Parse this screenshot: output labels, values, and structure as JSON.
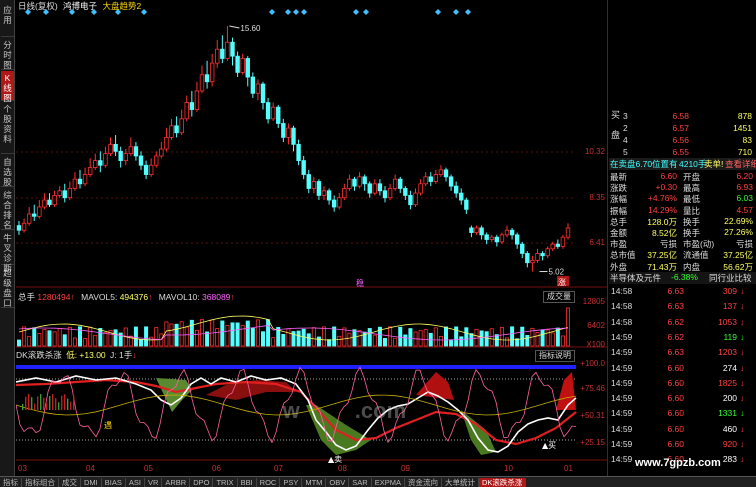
{
  "sidebar": {
    "tabs": [
      "应用",
      "分时图",
      "K线图",
      "个股资料",
      "自选股",
      "综合排名",
      "牛叉诊断",
      "超级盘口"
    ],
    "active": 2
  },
  "header": {
    "period": "日线(复权)",
    "stock": "鸿博电子",
    "overlay": "大盘趋势2"
  },
  "price_chart": {
    "high_label": "15.60",
    "low_label": "5.02",
    "event_mark": "稳",
    "event_mark2": "涨",
    "y_ticks": [
      "10.32",
      "8.35",
      "6.41"
    ],
    "candles": [
      [
        7.0,
        6.8,
        7.2,
        6.6
      ],
      [
        6.8,
        7.1,
        7.3,
        6.7
      ],
      [
        7.1,
        7.5,
        7.8,
        7.0
      ],
      [
        7.5,
        7.4,
        7.9,
        7.2
      ],
      [
        7.4,
        7.8,
        8.1,
        7.3
      ],
      [
        7.8,
        8.1,
        8.4,
        7.7
      ],
      [
        8.1,
        7.9,
        8.4,
        7.8
      ],
      [
        7.9,
        8.3,
        8.5,
        7.8
      ],
      [
        8.3,
        8.5,
        8.7,
        8.2
      ],
      [
        8.5,
        8.2,
        8.8,
        8.0
      ],
      [
        8.2,
        8.6,
        8.9,
        8.1
      ],
      [
        8.6,
        9.0,
        9.3,
        8.5
      ],
      [
        9.0,
        8.8,
        9.4,
        8.6
      ],
      [
        8.8,
        9.2,
        9.5,
        8.7
      ],
      [
        9.2,
        9.5,
        9.9,
        9.1
      ],
      [
        9.5,
        9.8,
        10.1,
        9.4
      ],
      [
        9.8,
        9.6,
        10.2,
        9.3
      ],
      [
        9.6,
        10.1,
        10.4,
        9.5
      ],
      [
        10.1,
        10.5,
        10.8,
        10.0
      ],
      [
        10.5,
        10.2,
        10.9,
        10.0
      ],
      [
        10.2,
        9.8,
        10.4,
        9.5
      ],
      [
        9.8,
        10.1,
        10.3,
        9.6
      ],
      [
        10.1,
        10.4,
        10.8,
        10.0
      ],
      [
        10.4,
        10.0,
        10.6,
        9.8
      ],
      [
        10.0,
        9.6,
        10.2,
        9.4
      ],
      [
        9.6,
        9.2,
        9.8,
        9.0
      ],
      [
        9.2,
        9.6,
        9.9,
        9.1
      ],
      [
        9.6,
        10.0,
        10.2,
        9.5
      ],
      [
        10.0,
        10.3,
        10.6,
        9.9
      ],
      [
        10.3,
        10.8,
        11.2,
        10.2
      ],
      [
        10.8,
        11.3,
        11.6,
        10.7
      ],
      [
        11.3,
        11.0,
        11.7,
        10.8
      ],
      [
        11.0,
        11.6,
        12.0,
        10.9
      ],
      [
        11.6,
        12.3,
        12.6,
        11.5
      ],
      [
        12.3,
        12.0,
        12.8,
        11.7
      ],
      [
        12.0,
        12.8,
        13.2,
        11.9
      ],
      [
        12.8,
        13.5,
        13.9,
        12.7
      ],
      [
        13.5,
        13.2,
        14.1,
        12.9
      ],
      [
        13.2,
        14.0,
        14.4,
        13.0
      ],
      [
        14.0,
        14.6,
        15.0,
        13.8
      ],
      [
        14.6,
        14.2,
        15.2,
        14.0
      ],
      [
        14.2,
        14.9,
        15.6,
        14.1
      ],
      [
        14.9,
        14.3,
        15.1,
        13.9
      ],
      [
        14.3,
        13.6,
        14.5,
        13.4
      ],
      [
        13.6,
        14.2,
        14.4,
        13.5
      ],
      [
        14.2,
        13.4,
        14.3,
        13.0
      ],
      [
        13.4,
        12.7,
        13.6,
        12.5
      ],
      [
        12.7,
        13.1,
        13.3,
        12.4
      ],
      [
        13.1,
        12.3,
        13.2,
        12.0
      ],
      [
        12.3,
        11.6,
        12.5,
        11.4
      ],
      [
        11.6,
        12.1,
        12.3,
        11.5
      ],
      [
        12.1,
        11.4,
        12.2,
        11.2
      ],
      [
        11.4,
        10.8,
        11.6,
        10.6
      ],
      [
        10.8,
        11.2,
        11.4,
        10.5
      ],
      [
        11.2,
        10.5,
        11.3,
        10.2
      ],
      [
        10.5,
        9.8,
        10.7,
        9.6
      ],
      [
        9.8,
        9.2,
        10.0,
        9.0
      ],
      [
        9.2,
        8.6,
        9.4,
        8.4
      ],
      [
        8.6,
        8.9,
        9.1,
        8.4
      ],
      [
        8.9,
        8.3,
        9.0,
        8.1
      ],
      [
        8.3,
        8.5,
        8.7,
        8.1
      ],
      [
        8.5,
        8.1,
        8.6,
        7.9
      ],
      [
        8.1,
        7.8,
        8.3,
        7.6
      ],
      [
        7.8,
        8.2,
        8.4,
        7.7
      ],
      [
        8.2,
        8.6,
        8.8,
        8.1
      ],
      [
        8.6,
        9.0,
        9.2,
        8.5
      ],
      [
        9.0,
        8.7,
        9.1,
        8.5
      ],
      [
        8.7,
        9.1,
        9.3,
        8.6
      ],
      [
        9.1,
        8.8,
        9.2,
        8.5
      ],
      [
        8.8,
        8.4,
        8.9,
        8.2
      ],
      [
        8.4,
        8.8,
        9.0,
        8.3
      ],
      [
        8.8,
        8.5,
        9.0,
        8.3
      ],
      [
        8.5,
        8.2,
        8.7,
        8.0
      ],
      [
        8.2,
        8.6,
        8.8,
        8.1
      ],
      [
        8.6,
        9.0,
        9.2,
        8.5
      ],
      [
        9.0,
        8.6,
        9.1,
        8.4
      ],
      [
        8.6,
        8.3,
        8.7,
        8.1
      ],
      [
        8.3,
        7.9,
        8.5,
        7.7
      ],
      [
        7.9,
        8.4,
        8.6,
        7.8
      ],
      [
        8.4,
        8.8,
        9.0,
        8.3
      ],
      [
        8.8,
        9.1,
        9.3,
        8.7
      ],
      [
        9.1,
        8.9,
        9.3,
        8.7
      ],
      [
        8.9,
        9.2,
        9.4,
        8.8
      ],
      [
        9.2,
        9.4,
        9.6,
        9.1
      ],
      [
        9.4,
        9.1,
        9.5,
        8.9
      ],
      [
        9.1,
        8.7,
        9.2,
        8.5
      ],
      [
        8.7,
        8.4,
        8.9,
        8.2
      ],
      [
        8.4,
        8.1,
        8.6,
        7.9
      ],
      [
        8.1,
        7.7,
        8.2,
        7.5
      ],
      [
        6.9,
        6.7,
        7.0,
        6.5
      ],
      [
        6.7,
        6.9,
        7.0,
        6.6
      ],
      [
        6.9,
        6.6,
        7.0,
        6.4
      ],
      [
        6.6,
        6.4,
        6.7,
        6.2
      ],
      [
        6.4,
        6.5,
        6.6,
        6.3
      ],
      [
        6.5,
        6.3,
        6.6,
        6.1
      ],
      [
        6.3,
        6.6,
        6.7,
        6.2
      ],
      [
        6.6,
        6.8,
        7.0,
        6.5
      ],
      [
        6.8,
        6.6,
        6.9,
        6.4
      ],
      [
        6.6,
        6.2,
        6.7,
        6.0
      ],
      [
        6.2,
        5.8,
        6.3,
        5.6
      ],
      [
        5.8,
        5.4,
        5.9,
        5.2
      ],
      [
        5.4,
        5.5,
        5.7,
        5.02
      ],
      [
        5.5,
        5.8,
        6.0,
        5.4
      ],
      [
        5.8,
        5.7,
        5.9,
        5.5
      ],
      [
        5.7,
        6.0,
        6.1,
        5.6
      ],
      [
        6.0,
        6.2,
        6.3,
        5.9
      ],
      [
        6.2,
        6.1,
        6.4,
        6.0
      ],
      [
        6.1,
        6.5,
        6.6,
        6.0
      ],
      [
        6.5,
        6.9,
        7.1,
        6.4
      ]
    ]
  },
  "volume_panel": {
    "label": "总手",
    "total": "1280494",
    "ma5_label": "MAVOL5:",
    "ma5": "494376",
    "ma10_label": "MAVOL10:",
    "ma10": "368089",
    "button": "成交量",
    "y_ticks": [
      "12805",
      "6402"
    ],
    "unit": "X100"
  },
  "indicator_panel": {
    "name": "DK滚跌杀涨",
    "param": "低: +13.00",
    "param2": "J: 1手",
    "button": "指标说明",
    "y_ticks": [
      "+100.0",
      "+75.46",
      "+50.31",
      "+25.15"
    ],
    "sell_label": "卖",
    "buy_label": "买",
    "signal": "遇"
  },
  "x_labels": [
    "03",
    "04",
    "05",
    "06",
    "07",
    "08",
    "09",
    "10",
    "01"
  ],
  "quote": {
    "asks": [
      {
        "level": "3",
        "price": "6.58",
        "vol": "878"
      },
      {
        "level": "2",
        "price": "6.57",
        "vol": "1451"
      },
      {
        "level": "4",
        "price": "6.56",
        "vol": "83"
      },
      {
        "level": "5",
        "price": "6.55",
        "vol": "710"
      }
    ],
    "side_labels": [
      "买",
      "盘"
    ],
    "trade_bar": {
      "left": "在卖盘6.70位置有",
      "mid": "4210手",
      "right": "卖单!",
      "link": "查看详细"
    },
    "stats": [
      {
        "l1": "最新",
        "v1": "6.60",
        "l2": "开盘",
        "v2": "6.20"
      },
      {
        "l1": "涨跌",
        "v1": "+0.30",
        "l2": "最高",
        "v2": "6.93"
      },
      {
        "l1": "涨幅",
        "v1": "+4.76%",
        "l2": "最低",
        "v2": "6.03"
      },
      {
        "l1": "振幅",
        "v1": "14.29%",
        "l2": "量比",
        "v2": "4.57"
      },
      {
        "l1": "总手",
        "v1": "128.0万",
        "l2": "换手",
        "v2": "22.69%"
      },
      {
        "l1": "金额",
        "v1": "8.52亿",
        "l2": "换手",
        "v2": "27.26%"
      },
      {
        "l1": "市盈",
        "v1": "亏损",
        "l2": "市盈(动)",
        "v2": "亏损"
      },
      {
        "l1": "总市值",
        "v1": "37.25亿",
        "l2": "流通值",
        "v2": "37.25亿"
      },
      {
        "l1": "外盘",
        "v1": "71.43万",
        "l2": "内盘",
        "v2": "56.62万"
      }
    ],
    "sector": {
      "name": "半导体及元件",
      "change": "-6.38%",
      "link": "同行业比较"
    },
    "ticks": [
      {
        "t": "14:58",
        "p": "6.63",
        "v": "309",
        "d": "down"
      },
      {
        "t": "14:58",
        "p": "6.63",
        "v": "137",
        "d": "down"
      },
      {
        "t": "14:58",
        "p": "6.62",
        "v": "1053",
        "d": "down"
      },
      {
        "t": "14:59",
        "p": "6.62",
        "v": "119",
        "d": "down"
      },
      {
        "t": "14:59",
        "p": "6.63",
        "v": "1203",
        "d": "down"
      },
      {
        "t": "14:59",
        "p": "6.60",
        "v": "274",
        "d": "down"
      },
      {
        "t": "14:59",
        "p": "6.60",
        "v": "1825",
        "d": "down"
      },
      {
        "t": "14:59",
        "p": "6.60",
        "v": "200",
        "d": "down"
      },
      {
        "t": "14:59",
        "p": "6.60",
        "v": "1331",
        "d": "down"
      },
      {
        "t": "14:59",
        "p": "6.60",
        "v": "460",
        "d": "down"
      },
      {
        "t": "14:59",
        "p": "6.60",
        "v": "920",
        "d": "down"
      },
      {
        "t": "14:59",
        "p": "6.60",
        "v": "283",
        "d": "down"
      }
    ]
  },
  "bottom_tabs": [
    "指标",
    "指标组合",
    "成交",
    "DMI",
    "BIAS",
    "ASI",
    "VR",
    "ARBR",
    "DPO",
    "TRIX",
    "BBI",
    "ROC",
    "PSY",
    "MTM",
    "OBV",
    "SAR",
    "EXPMA",
    "资金流向",
    "大单统计",
    "DK滚跌杀涨"
  ],
  "bottom_active": 19,
  "watermark": "www.7gpzb.com",
  "colors": {
    "up": "#ff3030",
    "down": "#54ffff",
    "accent": "#2020ff",
    "bg": "#000000",
    "gold": "#ffd700"
  }
}
